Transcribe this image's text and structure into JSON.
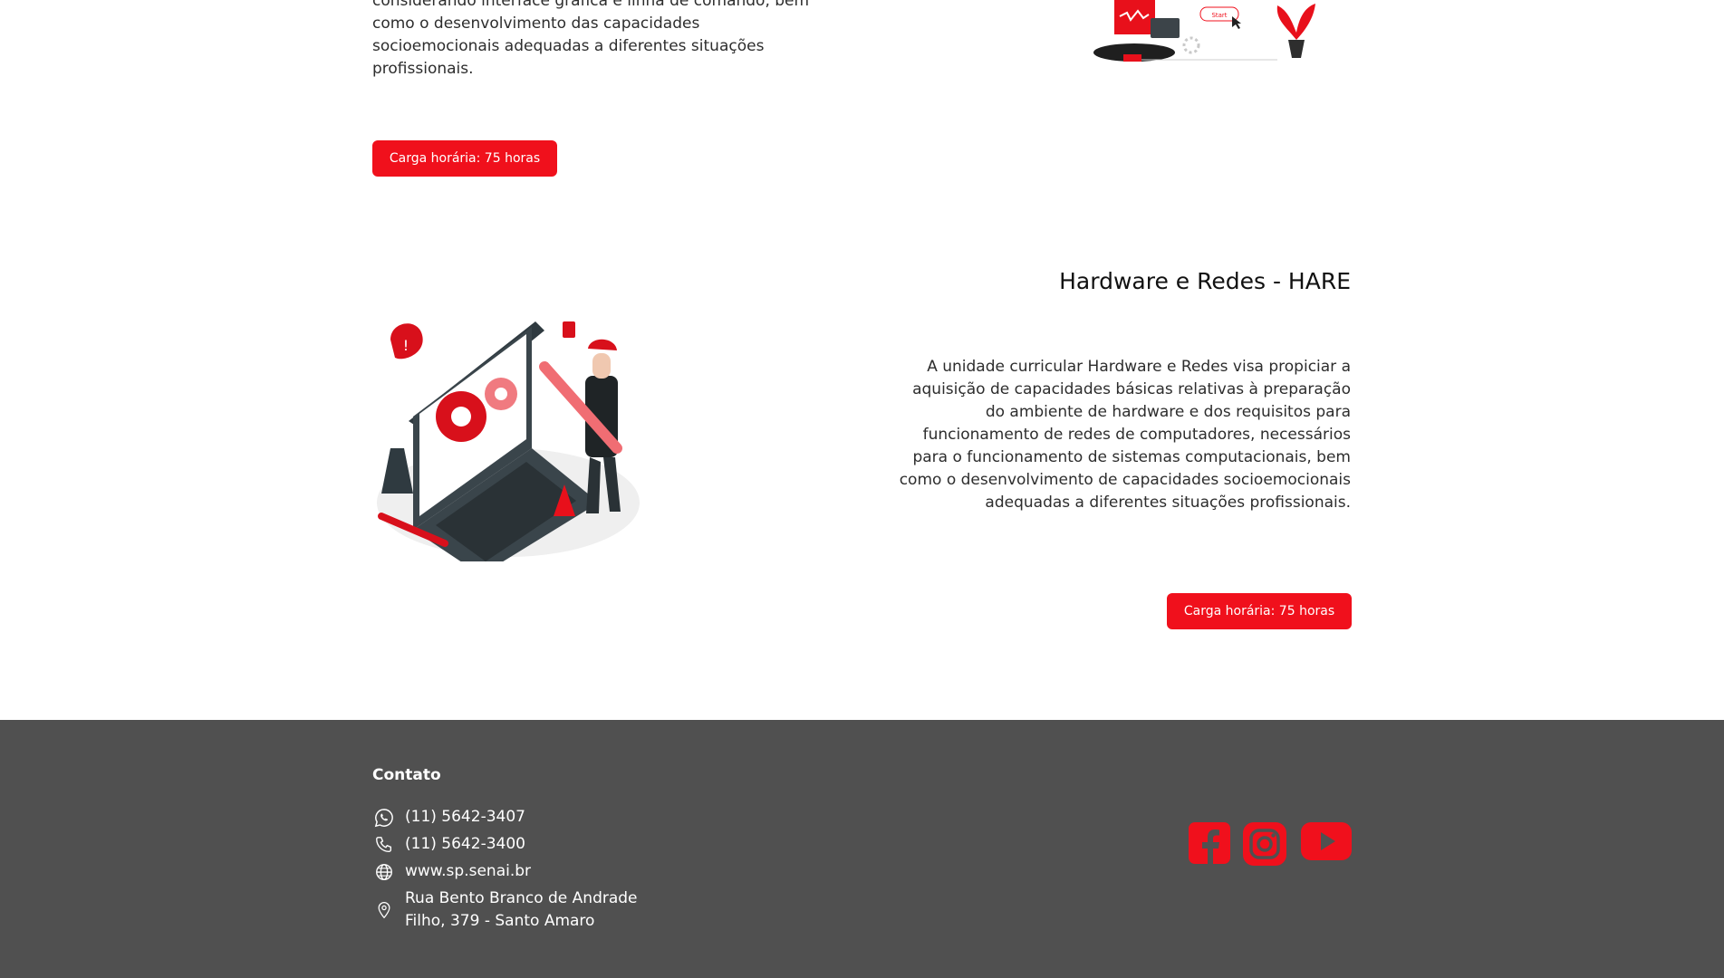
{
  "section1": {
    "description": "considerando interface gráfica e linha de comando, bem como o desenvolvimento das capacidades socioemocionais adequadas a diferentes situações profissionais.",
    "button_label": "Carga horária: 75 horas",
    "illustration_label": "Start"
  },
  "section2": {
    "title": "Hardware e Redes - HARE",
    "description": "A unidade curricular Hardware e Redes visa propiciar a aquisição de capacidades básicas relativas à preparação do ambiente de hardware e dos requisitos para funcionamento de redes de computadores, necessários para o funcionamento de sistemas computacionais, bem como o desenvolvimento de capacidades socioemocionais adequadas a diferentes situações profissionais.",
    "button_label": "Carga horária: 75 horas"
  },
  "footer": {
    "contact_title": "Contato",
    "whatsapp": "(11) 5642-3407",
    "phone": "(11) 5642-3400",
    "website": "www.sp.senai.br",
    "address_line1": "Rua Bento Branco de Andrade",
    "address_line2": "Filho, 379 - Santo Amaro",
    "social": [
      "facebook-icon",
      "instagram-icon",
      "youtube-icon"
    ]
  },
  "colors": {
    "accent": "#f0101c",
    "footer_bg": "#505050"
  }
}
